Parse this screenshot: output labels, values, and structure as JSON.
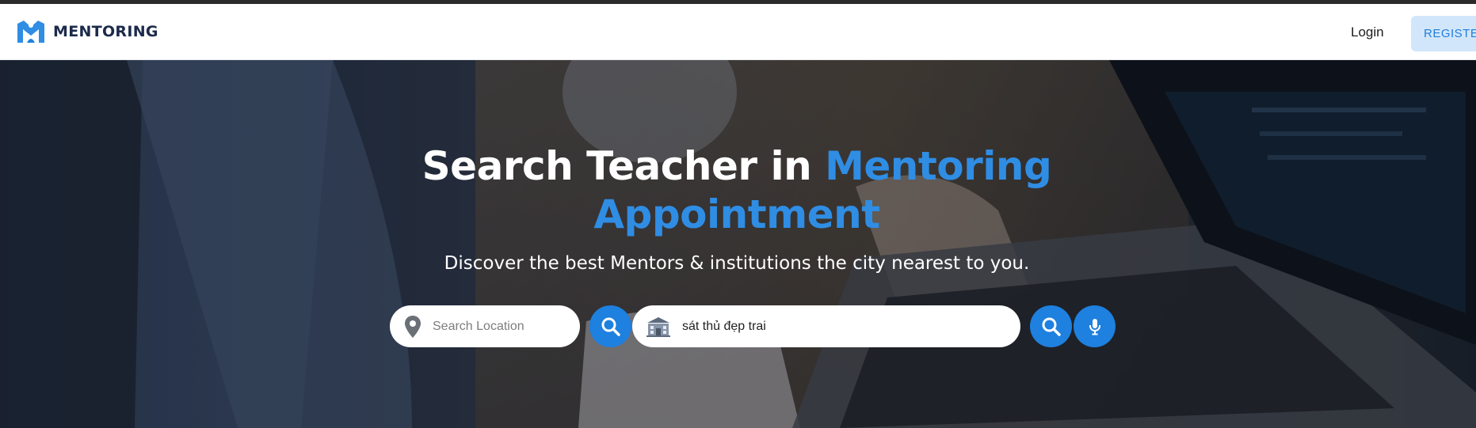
{
  "header": {
    "brand": "MENTORING",
    "login_label": "Login",
    "register_label": "REGISTER"
  },
  "hero": {
    "title_part1": "Search Teacher in ",
    "title_accent": "Mentoring Appointment",
    "subtitle": "Discover the best Mentors & institutions the city nearest to you."
  },
  "search": {
    "location_placeholder": "Search Location",
    "location_value": "",
    "keyword_value": "sát thủ đẹp trai"
  },
  "icons": {
    "logo": "mentoring-logo-icon",
    "location": "map-pin-icon",
    "search": "magnifier-icon",
    "school": "school-building-icon",
    "voice": "microphone-icon"
  },
  "colors": {
    "brand_navy": "#1c2a4b",
    "accent_blue": "#1e80df",
    "title_accent": "#2f8de4",
    "register_bg": "#d2e6fb"
  }
}
